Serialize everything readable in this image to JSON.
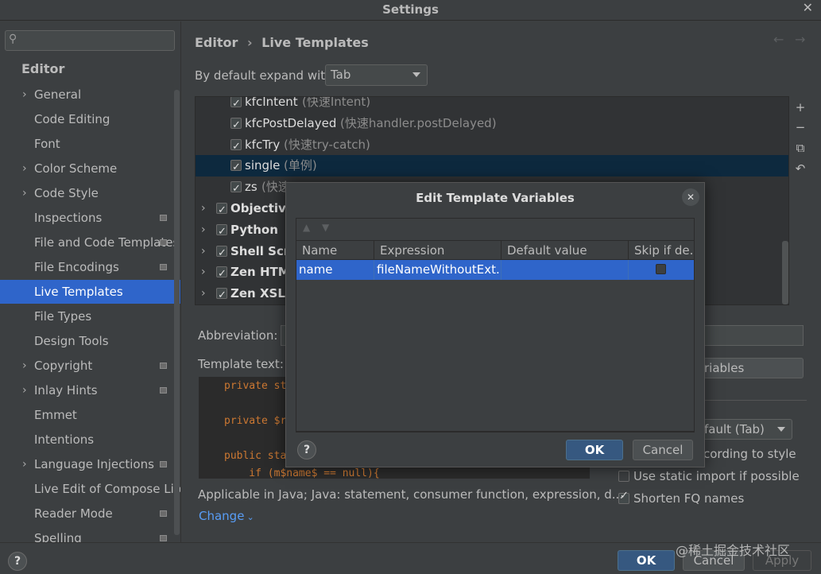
{
  "window": {
    "title": "Settings",
    "close_glyph": "✕"
  },
  "search": {
    "placeholder": "",
    "icon": "search-icon"
  },
  "sidebar": {
    "section": "Editor",
    "items": [
      {
        "label": "General",
        "expandable": true,
        "config": false
      },
      {
        "label": "Code Editing",
        "expandable": false,
        "config": false
      },
      {
        "label": "Font",
        "expandable": false,
        "config": false
      },
      {
        "label": "Color Scheme",
        "expandable": true,
        "config": false
      },
      {
        "label": "Code Style",
        "expandable": true,
        "config": false
      },
      {
        "label": "Inspections",
        "expandable": false,
        "config": true
      },
      {
        "label": "File and Code Templates",
        "expandable": false,
        "config": true
      },
      {
        "label": "File Encodings",
        "expandable": false,
        "config": true
      },
      {
        "label": "Live Templates",
        "expandable": false,
        "config": false,
        "selected": true
      },
      {
        "label": "File Types",
        "expandable": false,
        "config": false
      },
      {
        "label": "Design Tools",
        "expandable": false,
        "config": false
      },
      {
        "label": "Copyright",
        "expandable": true,
        "config": true
      },
      {
        "label": "Inlay Hints",
        "expandable": true,
        "config": true
      },
      {
        "label": "Emmet",
        "expandable": false,
        "config": false
      },
      {
        "label": "Intentions",
        "expandable": false,
        "config": false
      },
      {
        "label": "Language Injections",
        "expandable": true,
        "config": true
      },
      {
        "label": "Live Edit of Compose Lite",
        "expandable": false,
        "config": false
      },
      {
        "label": "Reader Mode",
        "expandable": false,
        "config": true
      },
      {
        "label": "Spelling",
        "expandable": false,
        "config": true
      }
    ]
  },
  "breadcrumb": {
    "parent": "Editor",
    "separator": "›",
    "current": "Live Templates",
    "back_glyph": "←",
    "forward_glyph": "→"
  },
  "expand": {
    "label": "By default expand with",
    "value": "Tab"
  },
  "templates": {
    "rows": [
      {
        "name": "kfcIntent",
        "desc": "(快速Intent)",
        "checked": true,
        "group": false
      },
      {
        "name": "kfcPostDelayed",
        "desc": "(快速handler.postDelayed)",
        "checked": true,
        "group": false
      },
      {
        "name": "kfcTry",
        "desc": "(快速try-catch)",
        "checked": true,
        "group": false
      },
      {
        "name": "single",
        "desc": "(单例)",
        "checked": true,
        "group": false,
        "selected": true
      },
      {
        "name": "zs",
        "desc": "(快速",
        "checked": true,
        "group": false
      },
      {
        "name": "Objective",
        "desc": "",
        "checked": true,
        "group": true
      },
      {
        "name": "Python",
        "desc": "",
        "checked": true,
        "group": true
      },
      {
        "name": "Shell Scri",
        "desc": "",
        "checked": true,
        "group": true
      },
      {
        "name": "Zen HTML",
        "desc": "",
        "checked": true,
        "group": true
      },
      {
        "name": "Zen XSL",
        "desc": "",
        "checked": true,
        "group": true
      }
    ],
    "tools": [
      "+",
      "−",
      "⧉",
      "↶"
    ]
  },
  "abbreviation": {
    "label": "Abbreviation:",
    "value": ""
  },
  "template_text": {
    "label": "Template text:",
    "lines": [
      "private st",
      "private $r",
      "public sta",
      "    if (m$name$ == null){"
    ]
  },
  "edit_variables_button": "riables",
  "options": {
    "expand_value": "fault (Tab)",
    "reformat": "cording to style",
    "static_import": "Use static import if possible",
    "static_import_checked": false,
    "shorten_fq": "Shorten FQ names",
    "shorten_fq_checked": true
  },
  "applicable": {
    "text": "Applicable in Java; Java: statement, consumer function, expression, d...",
    "change_link": "Change"
  },
  "bottom": {
    "help": "?",
    "ok": "OK",
    "cancel": "Cancel",
    "apply": "Apply",
    "watermark": "@稀土掘金技术社区"
  },
  "modal": {
    "title": "Edit Template Variables",
    "close_glyph": "✕",
    "toolbar": [
      "▲",
      "▼"
    ],
    "columns": [
      "Name",
      "Expression",
      "Default value",
      "Skip if de..."
    ],
    "rows": [
      {
        "name": "name",
        "expression": "fileNameWithoutExt...",
        "default": "",
        "skip": false
      }
    ],
    "help": "?",
    "ok": "OK",
    "cancel": "Cancel"
  },
  "colors": {
    "selection": "#2f65ca",
    "primary_button": "#365880",
    "background": "#3c3f41",
    "list_bg": "#313335"
  }
}
